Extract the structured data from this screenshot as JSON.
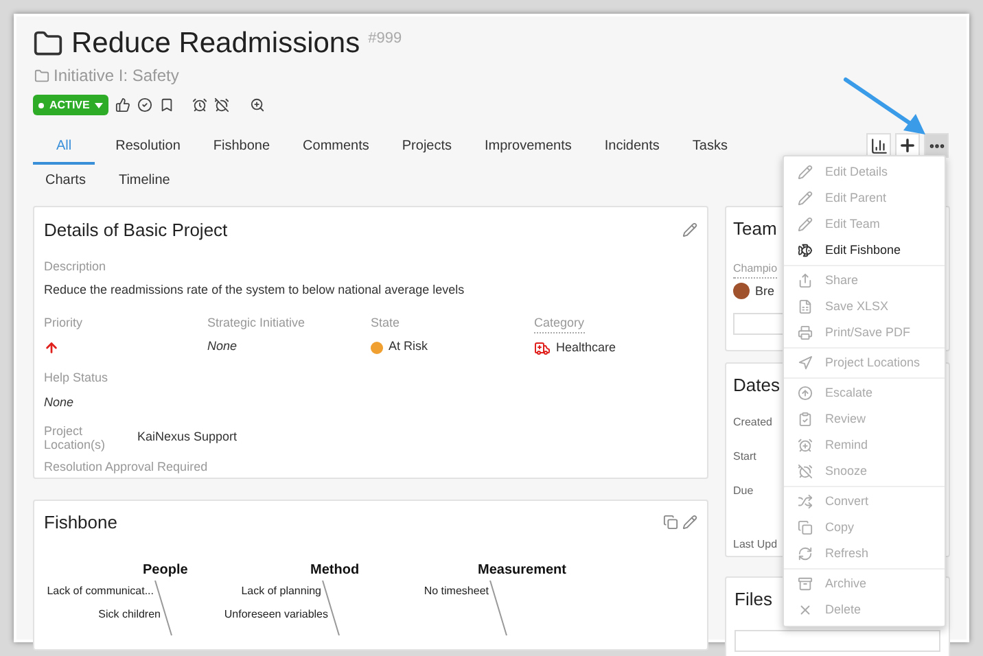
{
  "header": {
    "title": "Reduce Readmissions",
    "number": "#999",
    "parent": "Initiative I: Safety",
    "status": "ACTIVE"
  },
  "tabs": [
    {
      "label": "All",
      "selected": true
    },
    {
      "label": "Resolution",
      "selected": false
    },
    {
      "label": "Fishbone",
      "selected": false
    },
    {
      "label": "Comments",
      "selected": false
    },
    {
      "label": "Projects",
      "selected": false
    },
    {
      "label": "Improvements",
      "selected": false
    },
    {
      "label": "Incidents",
      "selected": false
    },
    {
      "label": "Tasks",
      "selected": false
    },
    {
      "label": "Charts",
      "selected": false
    },
    {
      "label": "Timeline",
      "selected": false
    }
  ],
  "toolbar": [
    {
      "kind": "chart",
      "selected": false
    },
    {
      "kind": "add",
      "selected": false
    },
    {
      "kind": "more",
      "selected": true
    }
  ],
  "details": {
    "title": "Details of Basic Project",
    "description_label": "Description",
    "description": "Reduce the readmissions rate of the system to below national average levels",
    "fields": [
      {
        "label": "Priority",
        "kind": "priority"
      },
      {
        "label": "Strategic Initiative",
        "kind": "empty",
        "value": "None"
      },
      {
        "label": "State",
        "kind": "state",
        "value": "At Risk",
        "color": "#f0a030"
      },
      {
        "label": "Category",
        "kind": "category",
        "value": "Healthcare"
      }
    ],
    "help_status": {
      "label": "Help Status",
      "value": "None"
    },
    "location": {
      "label": "Project Location(s)",
      "value": "KaiNexus Support"
    },
    "approval": "Resolution Approval Required"
  },
  "fishbone": {
    "title": "Fishbone",
    "categories": [
      {
        "name": "People",
        "causes": [
          "Lack of communicat...",
          "Sick children"
        ]
      },
      {
        "name": "Method",
        "causes": [
          "Lack of planning",
          "Unforeseen variables"
        ]
      },
      {
        "name": "Measurement",
        "causes": [
          "No timesheet"
        ]
      }
    ]
  },
  "team": {
    "title": "Team",
    "champion_label": "Champio",
    "member": "Bre"
  },
  "dates": {
    "title": "Dates",
    "labels": [
      "Created",
      "Start",
      "Due",
      "Last Upd"
    ]
  },
  "files": {
    "title": "Files"
  },
  "menu": [
    [
      {
        "label": "Edit Details",
        "disabled": true
      },
      {
        "label": "Edit Parent",
        "disabled": true
      },
      {
        "label": "Edit Team",
        "disabled": true
      },
      {
        "label": "Edit Fishbone",
        "disabled": false
      }
    ],
    [
      {
        "label": "Share",
        "disabled": true
      },
      {
        "label": "Save XLSX",
        "disabled": true
      },
      {
        "label": "Print/Save PDF",
        "disabled": true
      }
    ],
    [
      {
        "label": "Project Locations",
        "disabled": true
      }
    ],
    [
      {
        "label": "Escalate",
        "disabled": true
      },
      {
        "label": "Review",
        "disabled": true
      },
      {
        "label": "Remind",
        "disabled": true
      },
      {
        "label": "Snooze",
        "disabled": true
      }
    ],
    [
      {
        "label": "Convert",
        "disabled": true
      },
      {
        "label": "Copy",
        "disabled": true
      },
      {
        "label": "Refresh",
        "disabled": true
      }
    ],
    [
      {
        "label": "Archive",
        "disabled": true
      },
      {
        "label": "Delete",
        "disabled": true
      }
    ]
  ]
}
